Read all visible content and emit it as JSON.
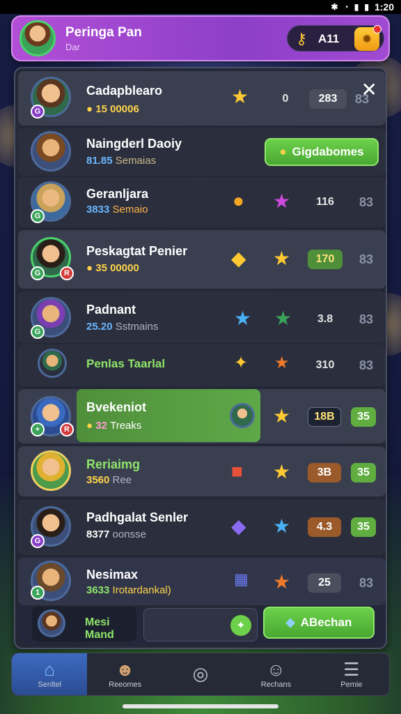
{
  "status_bar": {
    "time": "1:20"
  },
  "header": {
    "title": "Peringa Pan",
    "subtitle": "Dar",
    "coins": "A11"
  },
  "rows": [
    {
      "name": "Cadapblearo",
      "sub_value": "15 00006",
      "sub_rest": "",
      "count": "0",
      "pill": "283",
      "dim": "83"
    },
    {
      "name": "Naingderl Daoiy",
      "sub_value": "81.85",
      "sub_rest": "Semaias",
      "button": "Gigdabomes"
    },
    {
      "name": "Geranljara",
      "sub_value": "3833",
      "sub_rest": "Semaio",
      "pill": "116",
      "dim": "83"
    },
    {
      "name": "Peskagtat Penier",
      "sub_value": "35 00000",
      "sub_rest": "",
      "pill": "170",
      "dim": "83"
    },
    {
      "name": "Padnant",
      "sub_value": "25.20",
      "sub_rest": "Sstmains",
      "pill": "3.8",
      "dim": "83"
    },
    {
      "name": "Penlas Taarlal",
      "pill": "310",
      "dim": "83"
    },
    {
      "name": "Bvekeniot",
      "sub_value": "32",
      "sub_rest": "Treaks",
      "pill": "18B",
      "pill2": "35"
    },
    {
      "name": "Reriaimg",
      "sub_value": "3560",
      "sub_rest": "Ree",
      "pill": "3B",
      "pill2": "35"
    },
    {
      "name": "Padhgalat Senler",
      "sub_value": "8377",
      "sub_rest": "oonsse",
      "pill": "4.3",
      "pill2": "35"
    },
    {
      "name": "Nesimax",
      "sub_value": "3633",
      "sub_rest": "Irotardankal)",
      "pill": "25",
      "dim": "83"
    }
  ],
  "footer_row": {
    "name": "Mesi Mand",
    "button": "ABechan"
  },
  "nav": [
    {
      "label": "Senltel",
      "icon": "home-icon"
    },
    {
      "label": "Reeomes",
      "icon": "player-icon"
    },
    {
      "label": "",
      "icon": "compass-icon"
    },
    {
      "label": "Rechans",
      "icon": "mascot-icon"
    },
    {
      "label": "Pemie",
      "icon": "menu-icon"
    }
  ],
  "colors": {
    "header": "#9b46cf",
    "panel": "#24283a",
    "accent_green": "#5cc23f",
    "gold": "#ffc933"
  }
}
